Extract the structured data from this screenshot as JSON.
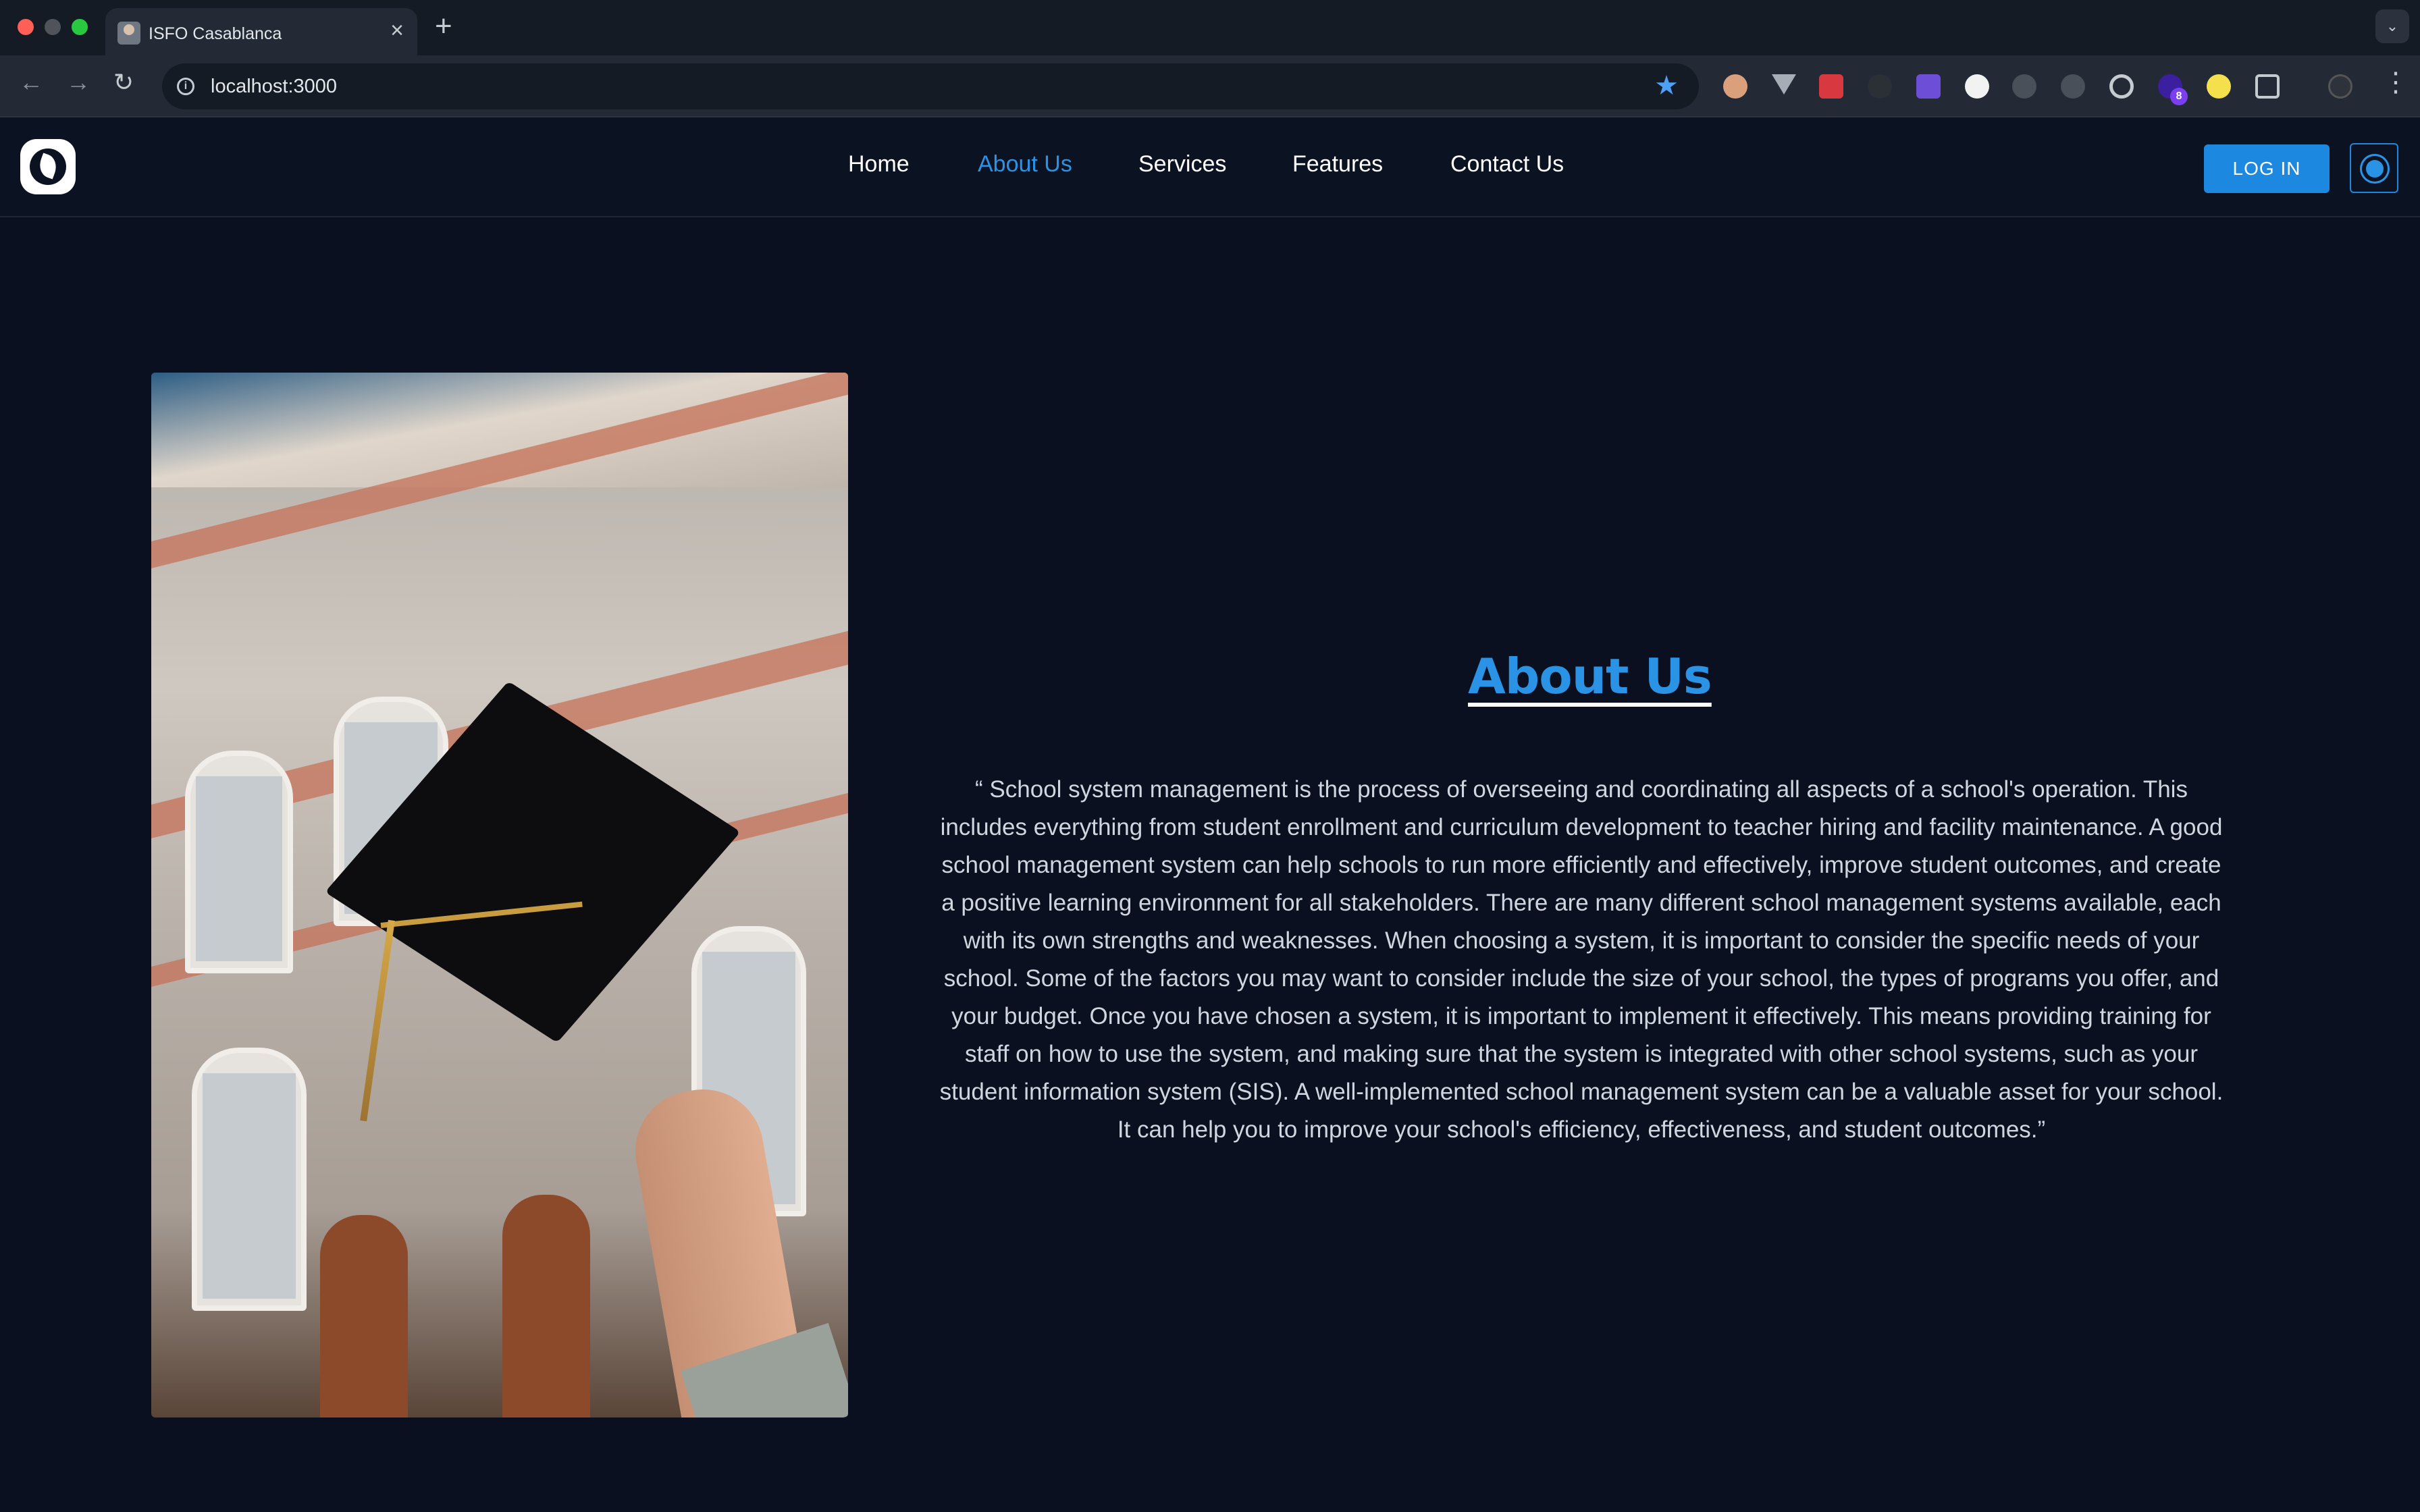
{
  "browser": {
    "tab_title": "ISFO Casablanca",
    "tab_close": "×",
    "new_tab": "+",
    "tab_menu": "⌄",
    "url": "localhost:3000",
    "extension_badge": "8"
  },
  "header": {
    "nav": [
      {
        "label": "Home",
        "active": false
      },
      {
        "label": "About Us",
        "active": true
      },
      {
        "label": "Services",
        "active": false
      },
      {
        "label": "Features",
        "active": false
      },
      {
        "label": "Contact Us",
        "active": false
      }
    ],
    "login_label": "LOG IN"
  },
  "about": {
    "title": "About Us",
    "body": "“ School system management is the process of overseeing and coordinating all aspects of a school's operation. This includes everything from student enrollment and curriculum development to teacher hiring and facility maintenance. A good school management system can help schools to run more efficiently and effectively, improve student outcomes, and create a positive learning environment for all stakeholders. There are many different school management systems available, each with its own strengths and weaknesses. When choosing a system, it is important to consider the specific needs of your school. Some of the factors you may want to consider include the size of your school, the types of programs you offer, and your budget. Once you have chosen a system, it is important to implement it effectively. This means providing training for staff on how to use the system, and making sure that the system is integrated with other school systems, such as your student information system (SIS). A well-implemented school management system can be a valuable asset for your school. It can help you to improve your school's efficiency, effectiveness, and student outcomes.”"
  },
  "colors": {
    "accent": "#2b93e6",
    "page_background": "#0a1020",
    "login_button": "#1c88e0"
  }
}
